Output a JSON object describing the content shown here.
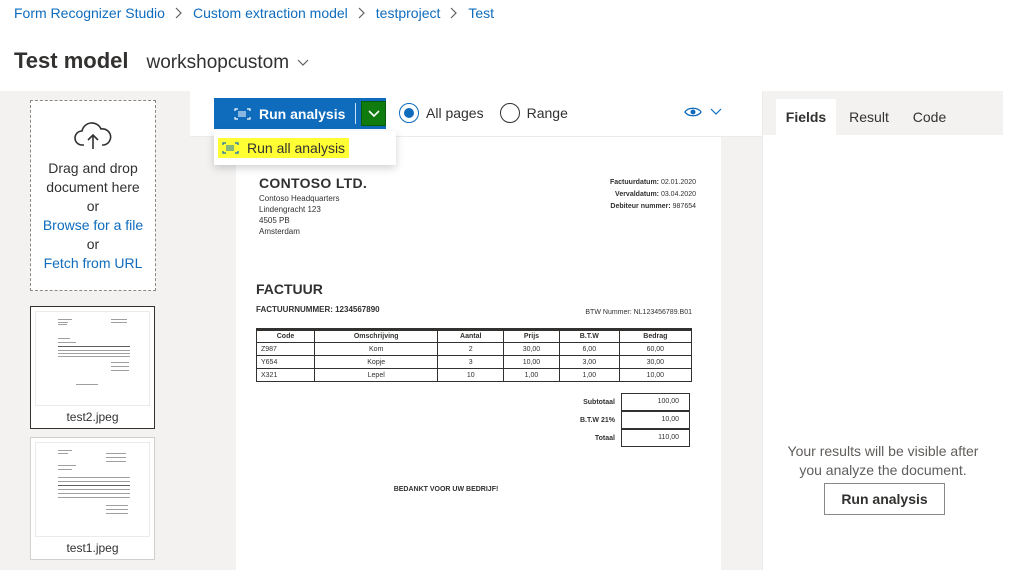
{
  "breadcrumb": {
    "items": [
      "Form Recognizer Studio",
      "Custom extraction model",
      "testproject",
      "Test"
    ]
  },
  "header": {
    "title": "Test model",
    "model_name": "workshopcustom"
  },
  "upload": {
    "drag_text_1": "Drag and drop",
    "drag_text_2": "document here",
    "or_1": "or",
    "browse_link": "Browse for a file",
    "or_2": "or",
    "fetch_link": "Fetch from URL"
  },
  "files": [
    {
      "name": "test2.jpeg",
      "selected": true
    },
    {
      "name": "test1.jpeg",
      "selected": false
    }
  ],
  "toolbar": {
    "run_label": "Run analysis",
    "dropdown_item": "Run all analysis",
    "radio_all": "All pages",
    "radio_range": "Range",
    "selected_radio": "All pages"
  },
  "document": {
    "company": "CONTOSO LTD.",
    "address": [
      "Contoso Headquarters",
      "Lindengracht 123",
      "4505 PB",
      "Amsterdam"
    ],
    "meta": [
      {
        "label": "Factuurdatum:",
        "value": "02.01.2020"
      },
      {
        "label": "Vervaldatum:",
        "value": "03.04.2020"
      },
      {
        "label": "Debiteur nummer:",
        "value": "987654"
      }
    ],
    "heading": "FACTUUR",
    "invoice_number": "FACTUURNUMMER: 1234567890",
    "btw_number": "BTW Nummer: NL123456789.B01",
    "table_headers": [
      "Code",
      "Omschrijving",
      "Aantal",
      "Prijs",
      "B.T.W",
      "Bedrag"
    ],
    "table_rows": [
      [
        "Z987",
        "Kom",
        "2",
        "30,00",
        "6,00",
        "60,00"
      ],
      [
        "Y654",
        "Kopje",
        "3",
        "10,00",
        "3,00",
        "30,00"
      ],
      [
        "X321",
        "Lepel",
        "10",
        "1,00",
        "1,00",
        "10,00"
      ]
    ],
    "totals": [
      {
        "label": "Subtotaal",
        "value": "100,00"
      },
      {
        "label": "B.T.W 21%",
        "value": "10,00"
      },
      {
        "label": "Totaal",
        "value": "110,00"
      }
    ],
    "thanks": "BEDANKT VOOR UW BEDRIJF!"
  },
  "results": {
    "tabs": [
      "Fields",
      "Result",
      "Code"
    ],
    "active_tab": "Fields",
    "empty_message": "Your results will be visible after you analyze the document.",
    "run_button": "Run analysis"
  },
  "colors": {
    "primary": "#0f6cbd",
    "split_button": "#107c10",
    "highlight": "#ffff33"
  },
  "icons": {
    "upload": "cloud-upload-icon",
    "run": "scan-icon",
    "view": "eye-icon"
  }
}
